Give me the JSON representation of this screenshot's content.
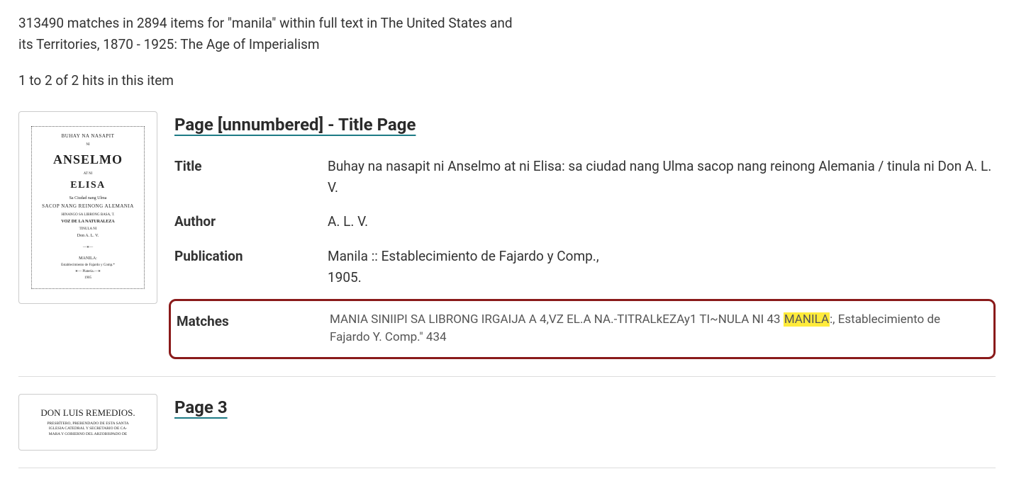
{
  "search": {
    "summary": "313490 matches in 2894 items for \"manila\" within full text in The United States and its Territories, 1870 - 1925: The Age of Imperialism",
    "range": "1 to 2 of 2 hits in this item"
  },
  "results": [
    {
      "page_link": "Page [unnumbered] - Title Page",
      "thumb": {
        "line1": "BUHAY NA NASAPIT",
        "big": "ANSELMO",
        "med": "ELISA",
        "sub1": "Sa Ciudad nang Ulma",
        "sub2": "SACOP NANG REINONG ALEMANIA",
        "voz": "VOZ DE LA NATURALEZA",
        "don": "Don A. L. V.",
        "city": "MANILA:",
        "est": "Establecimiento de Fajardo y Comp.*",
        "year": "1905"
      },
      "meta": {
        "title_label": "Title",
        "title_value": "Buhay na nasapit ni Anselmo at ni Elisa: sa ciudad nang Ulma sacop nang reinong Alemania / tinula ni Don A. L. V.",
        "author_label": "Author",
        "author_value": "A. L. V.",
        "publication_label": "Publication",
        "publication_value": "Manila :: Establecimiento de Fajardo y Comp.,",
        "publication_year": "1905.",
        "matches_label": "Matches",
        "matches_pre": "MANIA SINIIPI SA LIBRONG IRGAIJA A 4,VZ EL.A NA.-TITRALkEZAy1 TI~NULA NI 43 ",
        "matches_hl": "MANILA",
        "matches_post": ":, Establecimiento de Fajardo Y. Comp.\" 434"
      }
    },
    {
      "page_link": "Page 3",
      "thumb": {
        "big": "DON LUIS REMEDIOS.",
        "l1": "PRESBÍTERO, PREBENDADO DE ESTA SANTA",
        "l2": "IGLESIA CATEDRAL Y SECRETARIO DE CA-",
        "l3": "MARA Y GOBIERNO DEL ARZOBISPADO DE"
      }
    }
  ]
}
